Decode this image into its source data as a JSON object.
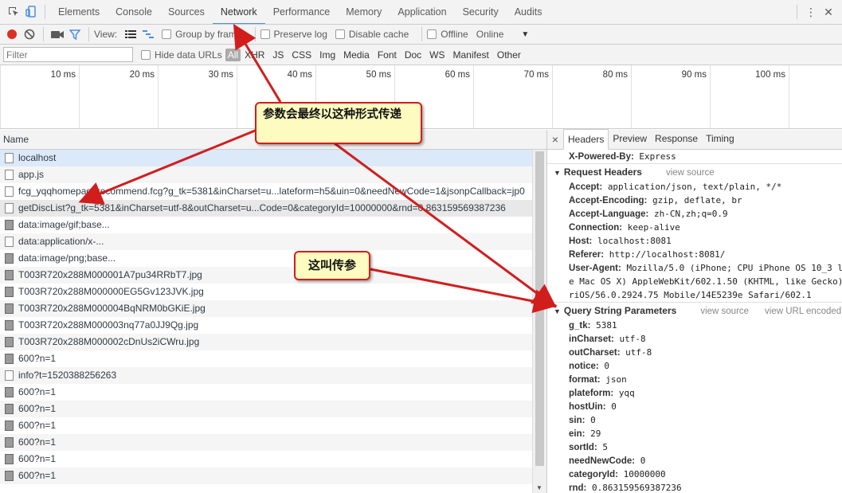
{
  "tabs": [
    "Elements",
    "Console",
    "Sources",
    "Network",
    "Performance",
    "Memory",
    "Application",
    "Security",
    "Audits"
  ],
  "toolbar": {
    "view_label": "View:",
    "group_by_frame": "Group by frame",
    "preserve_log": "Preserve log",
    "disable_cache": "Disable cache",
    "offline": "Offline",
    "throttle": "Online"
  },
  "filterbar": {
    "placeholder": "Filter",
    "hide_data_urls": "Hide data URLs",
    "types": [
      "All",
      "XHR",
      "JS",
      "CSS",
      "Img",
      "Media",
      "Font",
      "Doc",
      "WS",
      "Manifest",
      "Other"
    ]
  },
  "timeline_ticks": [
    "10 ms",
    "20 ms",
    "30 ms",
    "40 ms",
    "50 ms",
    "60 ms",
    "70 ms",
    "80 ms",
    "90 ms",
    "100 ms",
    "1"
  ],
  "list": {
    "header": "Name",
    "rows": [
      {
        "name": "localhost",
        "icon": "doc"
      },
      {
        "name": "app.js",
        "icon": "doc"
      },
      {
        "name": "fcg_yqqhomepagerecommend.fcg?g_tk=5381&inCharset=u...lateform=h5&uin=0&needNewCode=1&jsonpCallback=jp0",
        "icon": "doc"
      },
      {
        "name": "getDiscList?g_tk=5381&inCharset=utf-8&outCharset=u...Code=0&categoryId=10000000&rnd=0.8631595693872​36",
        "icon": "doc"
      },
      {
        "name": "data:image/gif;base...",
        "icon": "img"
      },
      {
        "name": "data:application/x-...",
        "icon": "doc"
      },
      {
        "name": "data:image/png;base...",
        "icon": "img"
      },
      {
        "name": "T003R720x288M000001A7pu34RRbT7.jpg",
        "icon": "img"
      },
      {
        "name": "T003R720x288M000000EG5Gv123JVK.jpg",
        "icon": "img"
      },
      {
        "name": "T003R720x288M000004BqNRM0bGKiE.jpg",
        "icon": "img"
      },
      {
        "name": "T003R720x288M000003nq77a0JJ9Qg.jpg",
        "icon": "img"
      },
      {
        "name": "T003R720x288M000002cDnUs2iCWru.jpg",
        "icon": "img"
      },
      {
        "name": "600?n=1",
        "icon": "img"
      },
      {
        "name": "info?t=1520388256263",
        "icon": "doc"
      },
      {
        "name": "600?n=1",
        "icon": "img"
      },
      {
        "name": "600?n=1",
        "icon": "img"
      },
      {
        "name": "600?n=1",
        "icon": "img"
      },
      {
        "name": "600?n=1",
        "icon": "img"
      },
      {
        "name": "600?n=1",
        "icon": "img"
      },
      {
        "name": "600?n=1",
        "icon": "img"
      }
    ]
  },
  "detail": {
    "close": "×",
    "tabs": [
      "Headers",
      "Preview",
      "Response",
      "Timing"
    ],
    "powered_by": {
      "key": "X-Powered-By:",
      "val": "Express"
    },
    "request_headers": {
      "title": "Request Headers",
      "view_source": "view source",
      "items": [
        {
          "key": "Accept:",
          "val": "application/json, text/plain, */*"
        },
        {
          "key": "Accept-Encoding:",
          "val": "gzip, deflate, br"
        },
        {
          "key": "Accept-Language:",
          "val": "zh-CN,zh;q=0.9"
        },
        {
          "key": "Connection:",
          "val": "keep-alive"
        },
        {
          "key": "Host:",
          "val": "localhost:8081"
        },
        {
          "key": "Referer:",
          "val": "http://localhost:8081/"
        },
        {
          "key": "User-Agent:",
          "val": "Mozilla/5.0 (iPhone; CPU iPhone OS 10_3 l"
        },
        {
          "key": "",
          "val": "e Mac OS X) AppleWebKit/602.1.50 (KHTML, like Gecko)"
        },
        {
          "key": "",
          "val": "riOS/56.0.2924.75 Mobile/14E5239e Safari/602.1"
        }
      ]
    },
    "query_params": {
      "title": "Query String Parameters",
      "view_source": "view source",
      "view_url_encoded": "view URL encoded",
      "items": [
        {
          "key": "g_tk:",
          "val": "5381"
        },
        {
          "key": "inCharset:",
          "val": "utf-8"
        },
        {
          "key": "outCharset:",
          "val": "utf-8"
        },
        {
          "key": "notice:",
          "val": "0"
        },
        {
          "key": "format:",
          "val": "json"
        },
        {
          "key": "plateform:",
          "val": "yqq"
        },
        {
          "key": "hostUin:",
          "val": "0"
        },
        {
          "key": "sin:",
          "val": "0"
        },
        {
          "key": "ein:",
          "val": "29"
        },
        {
          "key": "sortId:",
          "val": "5"
        },
        {
          "key": "needNewCode:",
          "val": "0"
        },
        {
          "key": "categoryId:",
          "val": "10000000"
        },
        {
          "key": "rnd:",
          "val": "0.8631595693872​36"
        }
      ]
    }
  },
  "annotations": {
    "callout1": "参数会最终以这种形式传递",
    "callout2": "这叫传参"
  },
  "colors": {
    "accent": "#4d8fe0",
    "record": "#d93025",
    "arrow": "#d21d1d",
    "callout_bg": "#fdfbbf"
  }
}
